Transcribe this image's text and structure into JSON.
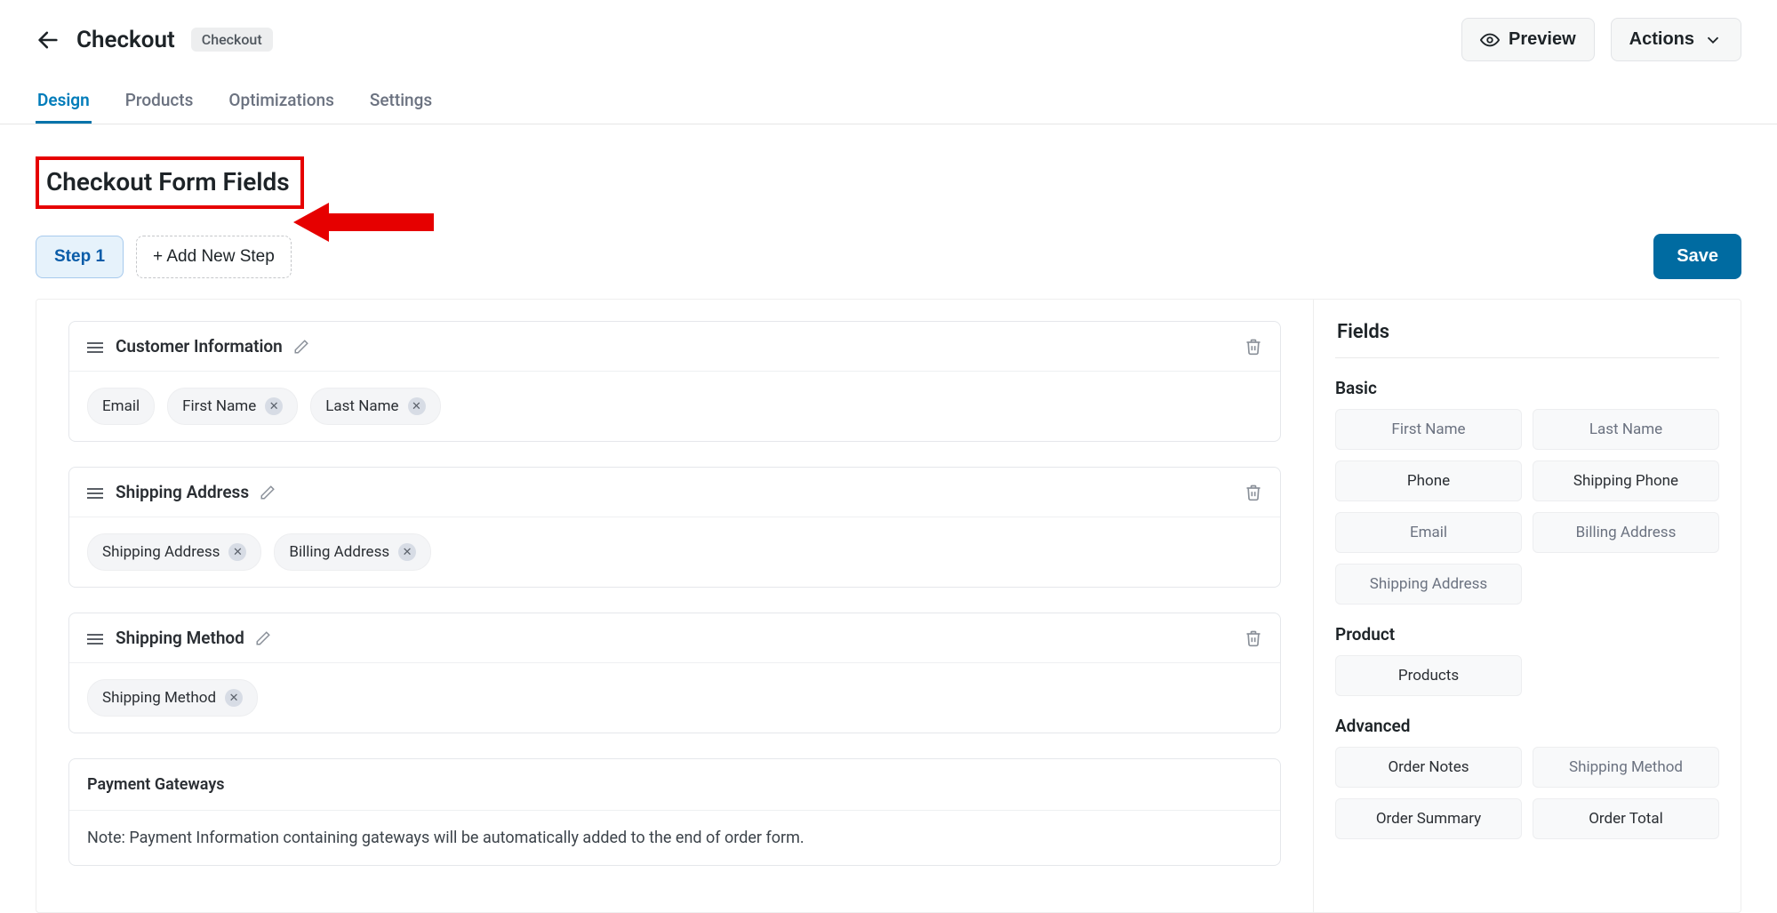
{
  "header": {
    "title": "Checkout",
    "badge": "Checkout",
    "preview": "Preview",
    "actions": "Actions"
  },
  "tabs": [
    {
      "label": "Design"
    },
    {
      "label": "Products"
    },
    {
      "label": "Optimizations"
    },
    {
      "label": "Settings"
    }
  ],
  "section_heading": "Checkout Form Fields",
  "steps": {
    "current": "Step 1",
    "add": "+ Add New Step",
    "save": "Save"
  },
  "cards": [
    {
      "title": "Customer Information",
      "chips": [
        {
          "label": "Email",
          "removable": false
        },
        {
          "label": "First Name",
          "removable": true
        },
        {
          "label": "Last Name",
          "removable": true
        }
      ]
    },
    {
      "title": "Shipping Address",
      "chips": [
        {
          "label": "Shipping Address",
          "removable": true
        },
        {
          "label": "Billing Address",
          "removable": true
        }
      ]
    },
    {
      "title": "Shipping Method",
      "chips": [
        {
          "label": "Shipping Method",
          "removable": true
        }
      ]
    }
  ],
  "payment_card": {
    "title": "Payment Gateways",
    "note": "Note: Payment Information containing gateways will be automatically added to the end of order form."
  },
  "sidebar": {
    "title": "Fields",
    "groups": [
      {
        "title": "Basic",
        "fields": [
          {
            "label": "First Name",
            "muted": true
          },
          {
            "label": "Last Name",
            "muted": true
          },
          {
            "label": "Phone",
            "muted": false
          },
          {
            "label": "Shipping Phone",
            "muted": false
          },
          {
            "label": "Email",
            "muted": true
          },
          {
            "label": "Billing Address",
            "muted": true
          },
          {
            "label": "Shipping Address",
            "muted": true
          }
        ]
      },
      {
        "title": "Product",
        "fields": [
          {
            "label": "Products",
            "muted": false
          }
        ]
      },
      {
        "title": "Advanced",
        "fields": [
          {
            "label": "Order Notes",
            "muted": false
          },
          {
            "label": "Shipping Method",
            "muted": true
          },
          {
            "label": "Order Summary",
            "muted": false
          },
          {
            "label": "Order Total",
            "muted": false
          }
        ]
      }
    ]
  }
}
